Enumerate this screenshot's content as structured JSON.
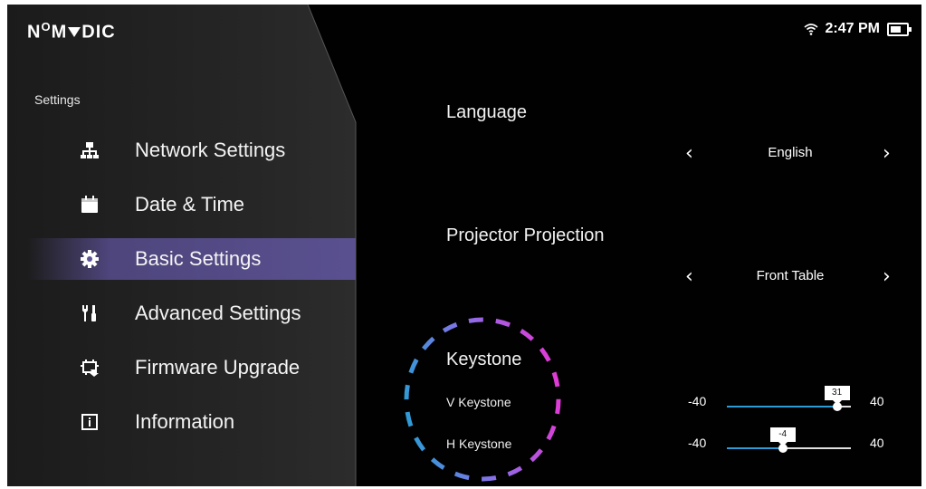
{
  "header": {
    "logo": "NOMVDIC",
    "time": "2:47 PM"
  },
  "sidebar": {
    "section_title": "Settings",
    "items": [
      {
        "label": "Network Settings",
        "icon": "network-icon"
      },
      {
        "label": "Date & Time",
        "icon": "calendar-icon"
      },
      {
        "label": "Basic Settings",
        "icon": "gear-icon",
        "active": true
      },
      {
        "label": "Advanced Settings",
        "icon": "tools-icon"
      },
      {
        "label": "Firmware Upgrade",
        "icon": "firmware-icon"
      },
      {
        "label": "Information",
        "icon": "info-icon"
      }
    ]
  },
  "main": {
    "language": {
      "title": "Language",
      "value": "English"
    },
    "projection": {
      "title": "Projector Projection",
      "value": "Front Table"
    },
    "keystone": {
      "title": "Keystone",
      "v": {
        "label": "V Keystone",
        "min": "-40",
        "max": "40",
        "value": "31"
      },
      "h": {
        "label": "H Keystone",
        "min": "-40",
        "max": "40",
        "value": "-4"
      }
    }
  },
  "colors": {
    "active_bg": "#5c5296",
    "slider_fill": "#2f9bd6",
    "ring_start": "#2f9bd6",
    "ring_end": "#e23ad6"
  }
}
